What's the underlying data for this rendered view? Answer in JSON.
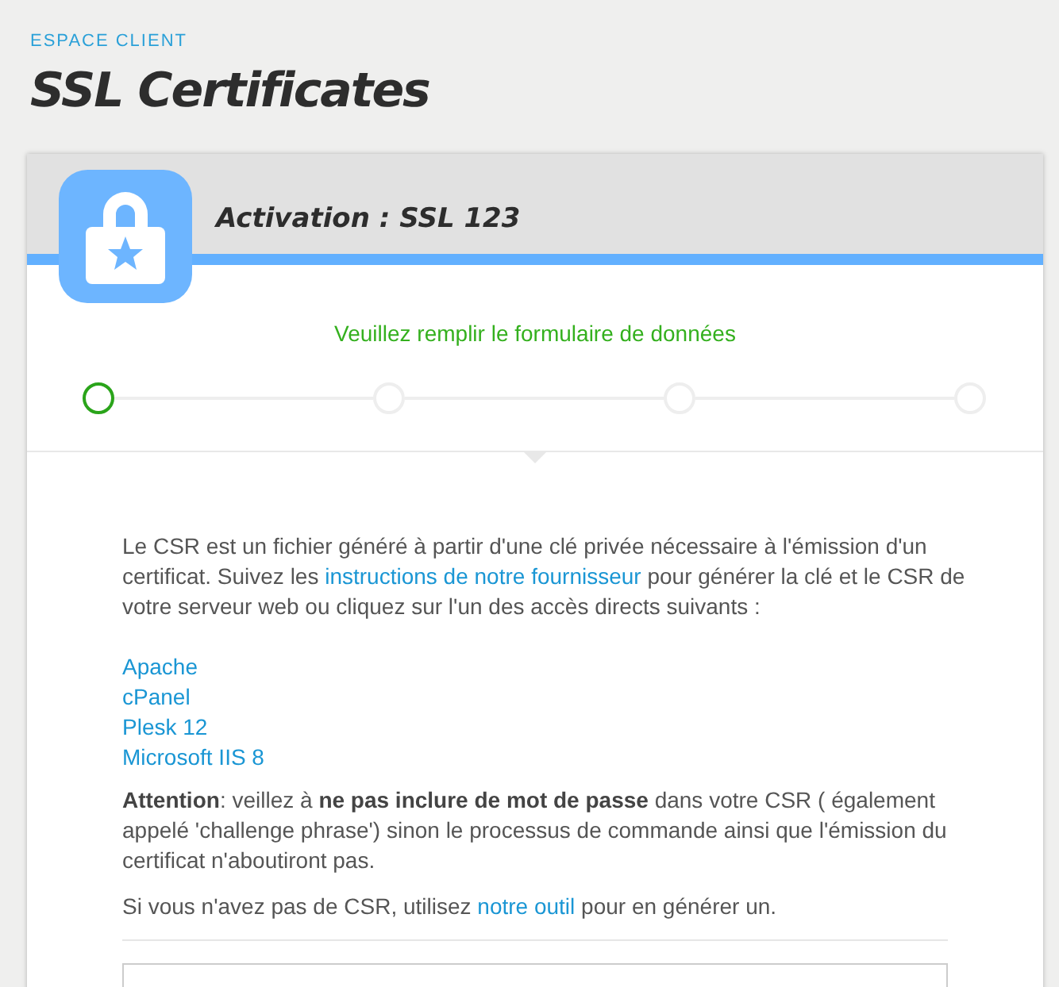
{
  "breadcrumb": "ESPACE CLIENT",
  "title": "SSL Certificates",
  "card": {
    "heading": "Activation : SSL 123",
    "subtitle": "Veuillez remplir le formulaire de données",
    "steps": [
      {
        "selected": true
      },
      {
        "selected": false
      },
      {
        "selected": false
      },
      {
        "selected": false
      }
    ],
    "intro": [
      {
        "kind": "text",
        "text": "Le CSR est un fichier généré à partir d'une clé privée nécessaire à l'émission d'un certificat. Suivez les "
      },
      {
        "kind": "link",
        "text": "instructions de notre fournisseur"
      },
      {
        "kind": "text",
        "text": " pour générer la clé et le CSR de votre serveur web ou cliquez sur l'un des accès directs suivants :"
      }
    ],
    "server_links": [
      "Apache",
      "cPanel",
      "Plesk 12",
      "Microsoft IIS 8"
    ],
    "warning": "**Attention**: veillez à **ne pas inclure de mot de passe** dans votre CSR ( également appelé 'challenge phrase') sinon le processus de commande ainsi que l'émission du certificat n'aboutiront pas.",
    "tool_note": [
      {
        "kind": "text",
        "text": "Si vous n'avez pas de CSR, utilisez "
      },
      {
        "kind": "link",
        "text": "notre outil"
      },
      {
        "kind": "text",
        "text": " pour en générer un."
      }
    ]
  }
}
